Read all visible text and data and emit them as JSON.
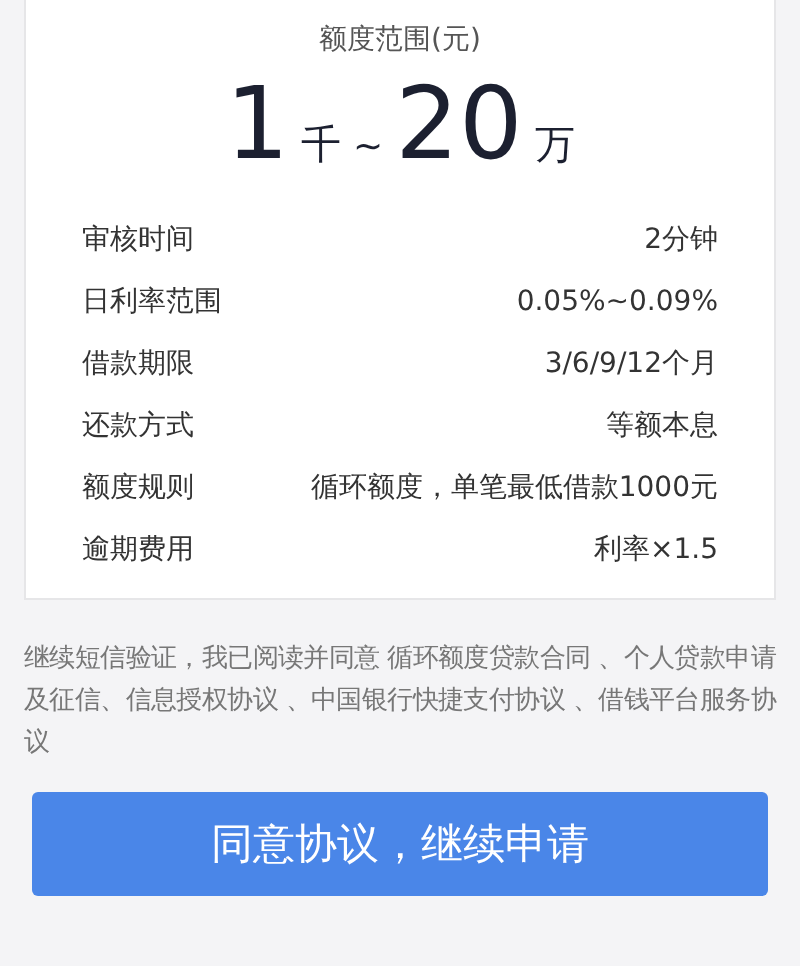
{
  "quota": {
    "label": "额度范围(元)",
    "min_value": "1",
    "min_unit": "千",
    "separator": "~",
    "max_value": "20",
    "max_unit": "万"
  },
  "details": [
    {
      "label": "审核时间",
      "value": "2分钟"
    },
    {
      "label": "日利率范围",
      "value": "0.05%~0.09%"
    },
    {
      "label": "借款期限",
      "value": "3/6/9/12个月"
    },
    {
      "label": "还款方式",
      "value": "等额本息"
    },
    {
      "label": "额度规则",
      "value": "循环额度，单笔最低借款1000元"
    },
    {
      "label": "逾期费用",
      "value": "利率×1.5"
    }
  ],
  "agreement": "继续短信验证，我已阅读并同意 循环额度贷款合同 、个人贷款申请及征信、信息授权协议 、中国银行快捷支付协议 、借钱平台服务协议",
  "button": "同意协议，继续申请"
}
